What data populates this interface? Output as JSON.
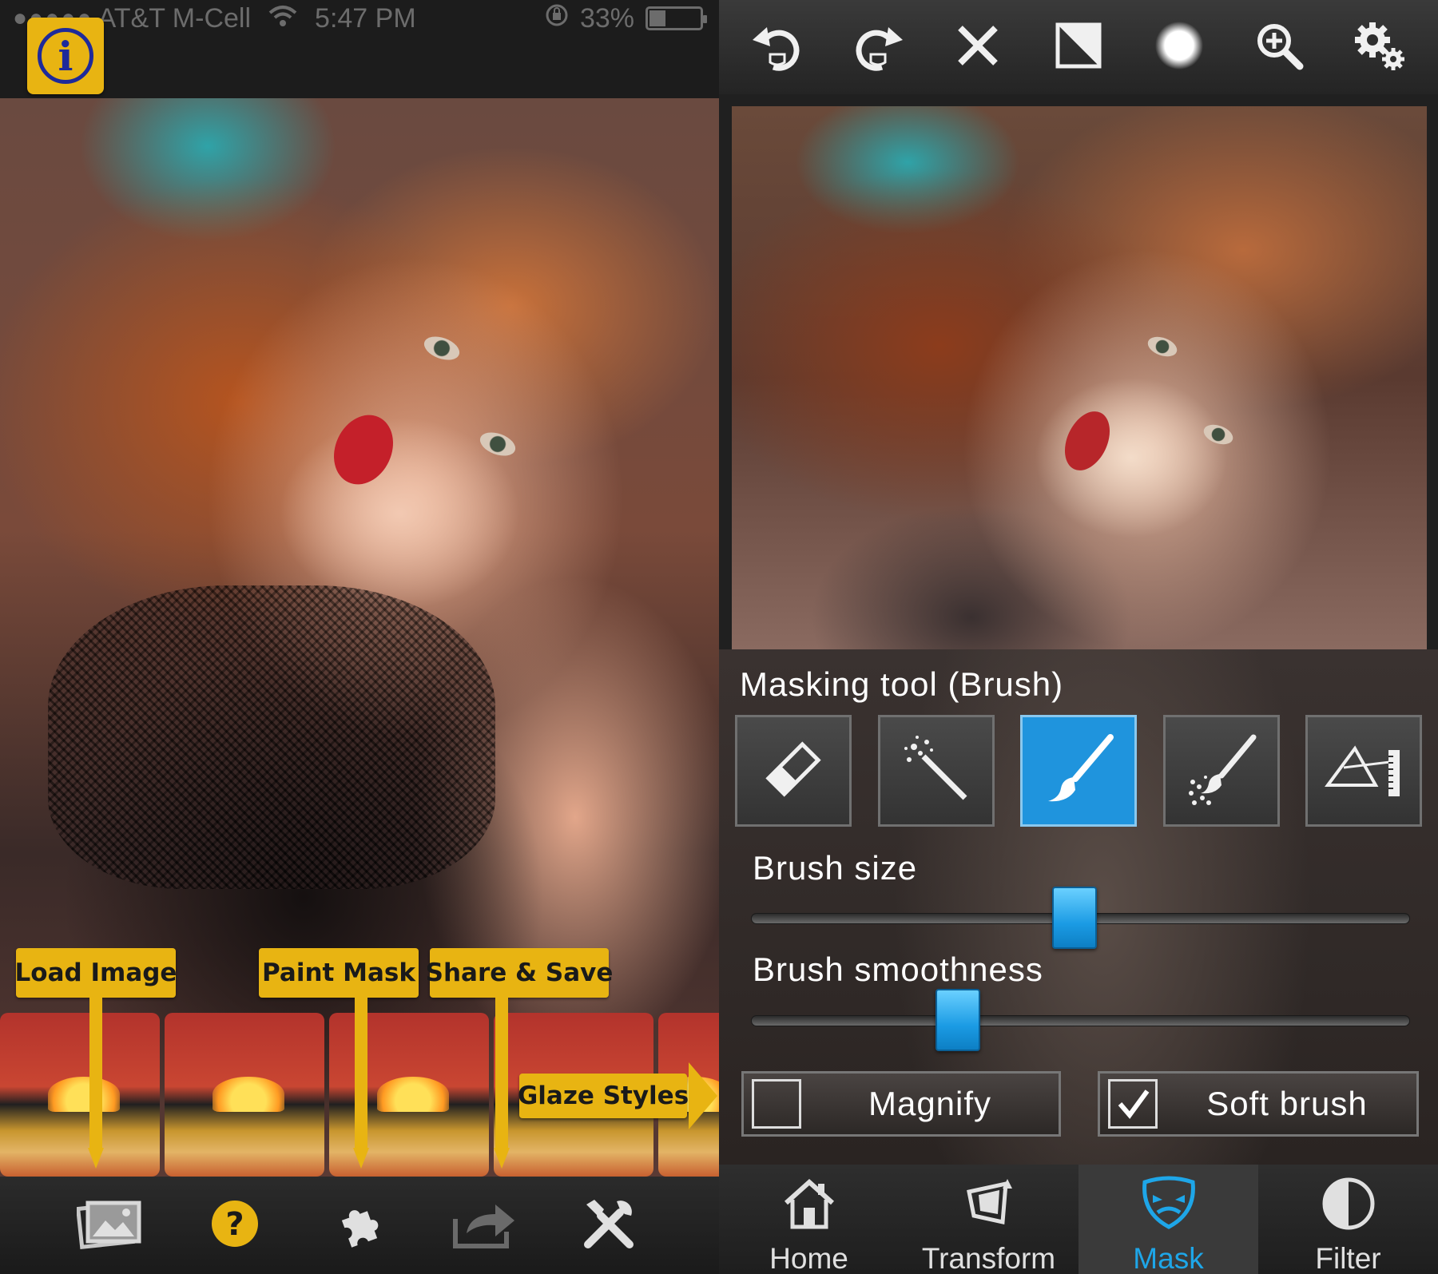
{
  "left": {
    "status_bar": {
      "signal": "●●●●●",
      "carrier": "AT&T M-Cell",
      "time": "5:47 PM",
      "battery_percent_text": "33%",
      "battery_level": 0.33
    },
    "info_button": {
      "glyph": "i",
      "icon": "info-icon"
    },
    "guide_tags": {
      "load_image": "Load Image",
      "paint_mask": "Paint Mask",
      "share_save": "Share & Save",
      "glaze_styles": "Glaze Styles"
    },
    "thumbnails_count": 5,
    "toolbar": [
      "gallery-icon",
      "help-icon",
      "puzzle-icon",
      "share-icon",
      "tools-icon"
    ],
    "accent_color": "#e8b412"
  },
  "right": {
    "toolbar": [
      "undo-icon",
      "redo-icon",
      "close-icon",
      "invert-icon",
      "brush-dot-icon",
      "zoom-in-icon",
      "settings-icon"
    ],
    "mask_panel": {
      "title": "Masking tool (Brush)",
      "tools": [
        "eraser-icon",
        "magic-wand-icon",
        "brush-icon",
        "spray-brush-icon",
        "gradient-ruler-icon"
      ],
      "active_tool": "brush-icon",
      "brush_size": {
        "label": "Brush size",
        "value": 0.49
      },
      "brush_smoothness": {
        "label": "Brush smoothness",
        "value": 0.3
      },
      "magnify": {
        "label": "Magnify",
        "checked": false
      },
      "soft_brush": {
        "label": "Soft brush",
        "checked": true
      }
    },
    "nav": {
      "home": "Home",
      "transform": "Transform",
      "mask": "Mask",
      "filter": "Filter",
      "active": "Mask"
    },
    "accent_color": "#1ea6e8"
  }
}
